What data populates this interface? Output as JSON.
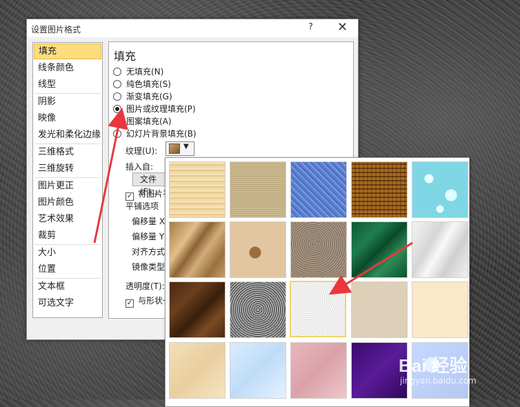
{
  "dialog": {
    "title": "设置图片格式",
    "help": "?",
    "close": "✕"
  },
  "sidebar": {
    "items": [
      {
        "label": "填充",
        "selected": true
      },
      {
        "label": "线条颜色"
      },
      {
        "label": "线型"
      },
      {
        "label": "阴影"
      },
      {
        "label": "映像"
      },
      {
        "label": "发光和柔化边缘"
      },
      {
        "label": "三维格式"
      },
      {
        "label": "三维旋转"
      },
      {
        "label": "图片更正"
      },
      {
        "label": "图片颜色"
      },
      {
        "label": "艺术效果"
      },
      {
        "label": "裁剪"
      },
      {
        "label": "大小"
      },
      {
        "label": "位置"
      },
      {
        "label": "文本框"
      },
      {
        "label": "可选文字"
      }
    ]
  },
  "panel": {
    "heading": "填充",
    "options": [
      {
        "label": "无填充(N)",
        "checked": false
      },
      {
        "label": "纯色填充(S)",
        "checked": false
      },
      {
        "label": "渐变填充(G)",
        "checked": false
      },
      {
        "label": "图片或纹理填充(P)",
        "checked": true
      },
      {
        "label": "图案填充(A)",
        "checked": false
      },
      {
        "label": "幻灯片背景填充(B)",
        "checked": false
      }
    ],
    "texture_label": "纹理(U):",
    "insert_from": "插入自:",
    "file_button": "文件(F)...",
    "tile_checkbox": "将图片平",
    "tile_options": "平铺选项",
    "offset_x": "偏移量 X",
    "offset_y": "偏移量 Y",
    "align": "对齐方式",
    "mirror": "镜像类型",
    "transparency": "透明度(T):",
    "rotate_with_shape": "与形状一"
  },
  "gallery": {
    "textures": [
      "papyrus",
      "canvas",
      "denim",
      "woven",
      "water-droplets",
      "crumpled-paper",
      "fossil",
      "sand",
      "green-marble",
      "white-marble",
      "brown-marble",
      "granite",
      "white-textured",
      "recycled-paper",
      "parchment",
      "light-paper",
      "blue-tissue",
      "pink-tissue",
      "purple-mesh",
      "bouquet"
    ],
    "selected_index": 12
  },
  "watermark": {
    "text": "Bai 经验",
    "sub": "jingyan.baidu.com"
  },
  "colors": {
    "selected": "#fcdc7e",
    "arrow": "#e8383d"
  }
}
